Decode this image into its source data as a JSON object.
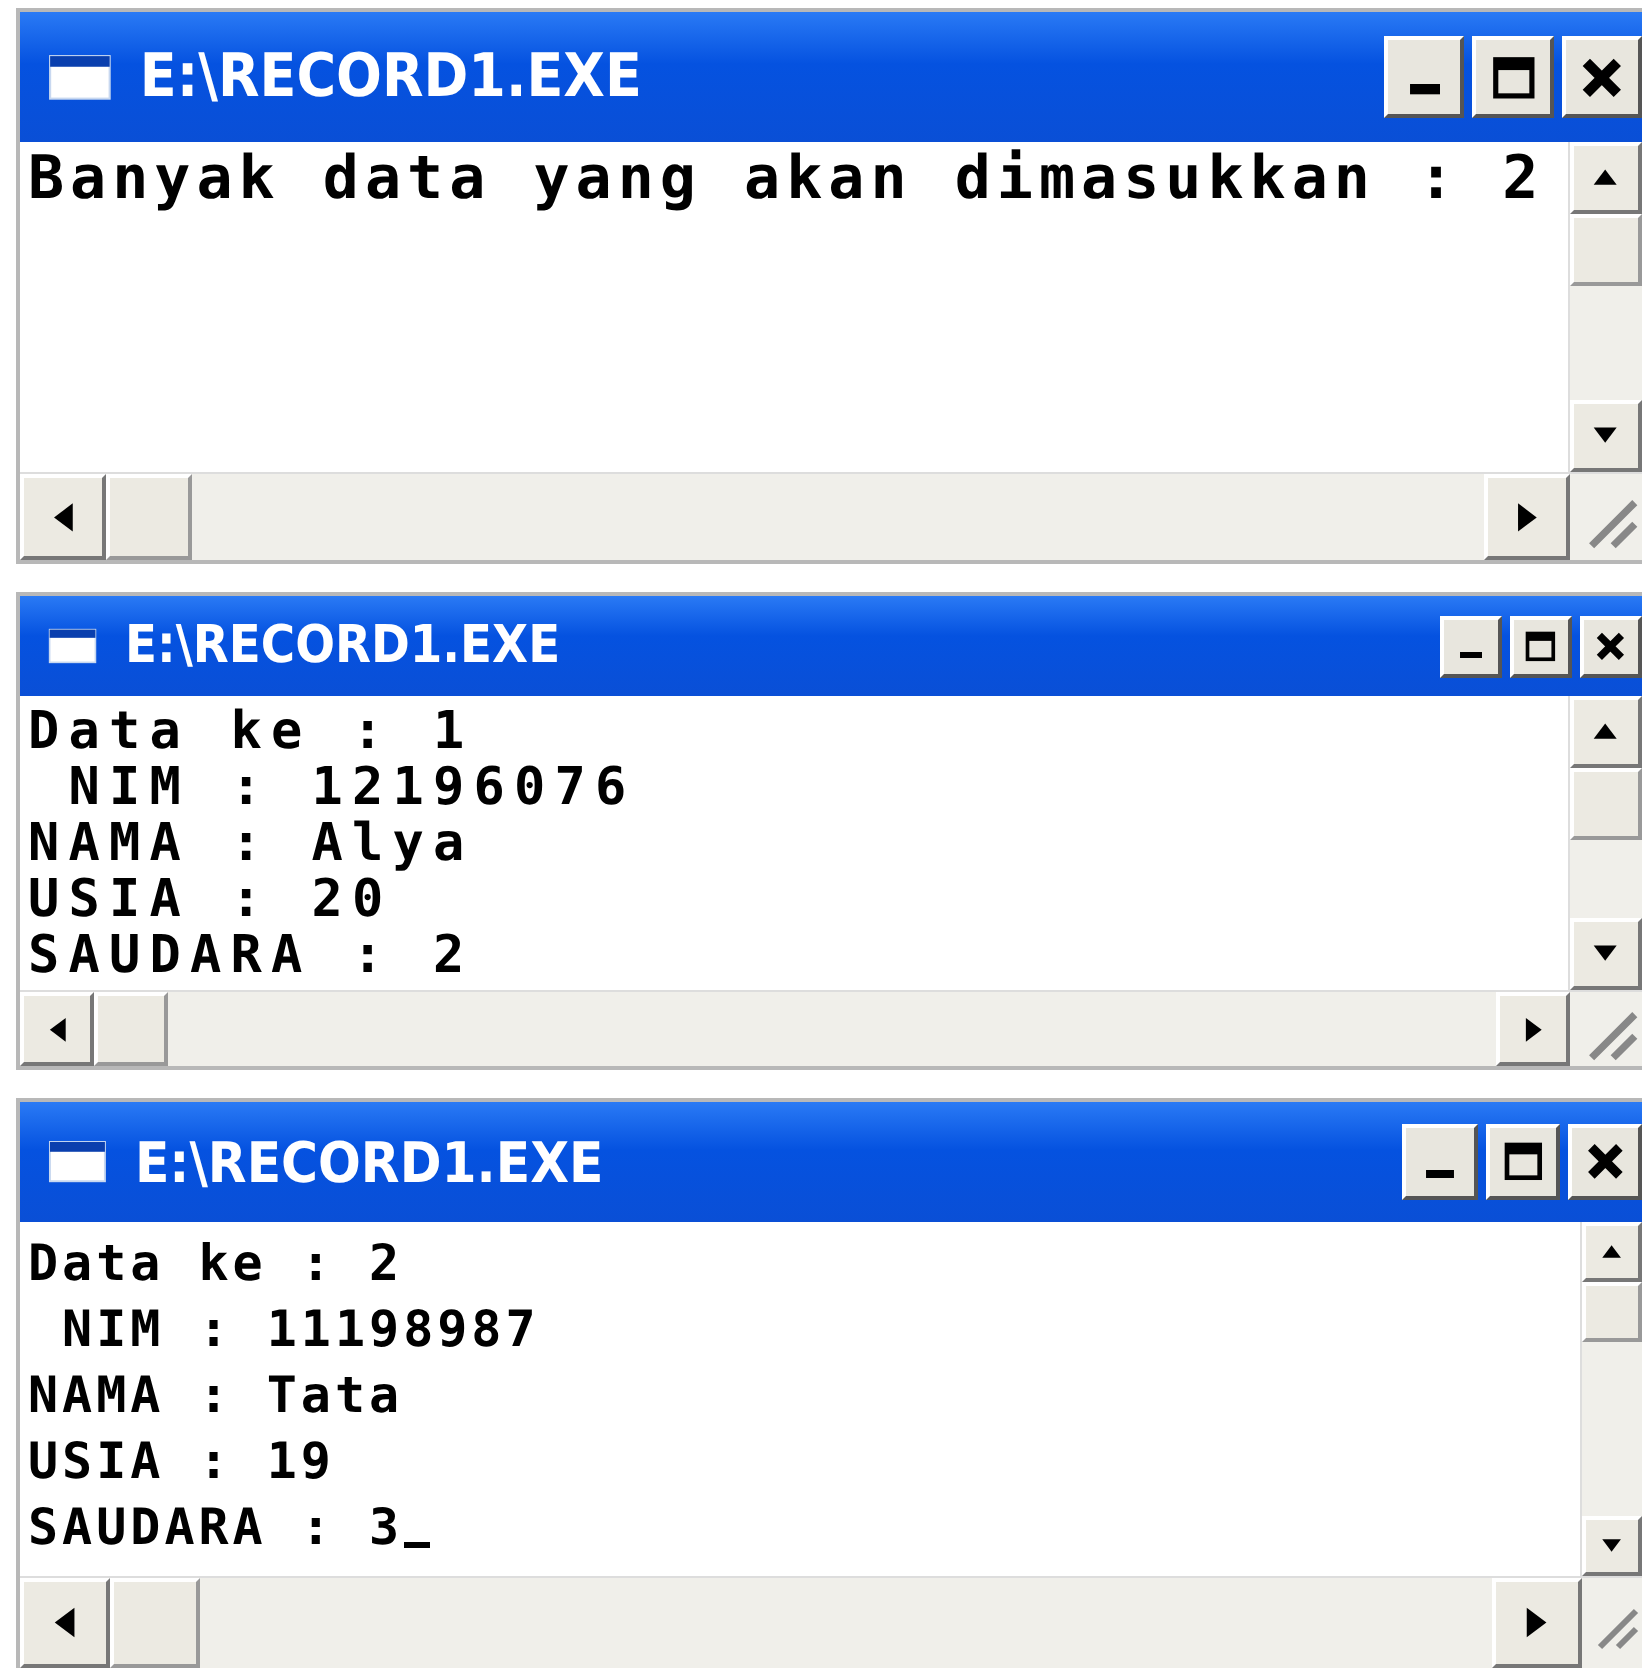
{
  "windows": [
    {
      "title": "E:\\RECORD1.EXE",
      "lines": [
        "Banyak data yang akan dimasukkan : 2"
      ],
      "cursor": false
    },
    {
      "title": "E:\\RECORD1.EXE",
      "lines": [
        "Data ke : 1",
        " NIM : 12196076",
        "NAMA : Alya",
        "USIA : 20",
        "SAUDARA : 2"
      ],
      "cursor": false
    },
    {
      "title": "E:\\RECORD1.EXE",
      "lines": [
        "Data ke : 2",
        " NIM : 11198987",
        "NAMA : Tata",
        "USIA : 19",
        "SAUDARA : 3"
      ],
      "cursor": true
    }
  ]
}
